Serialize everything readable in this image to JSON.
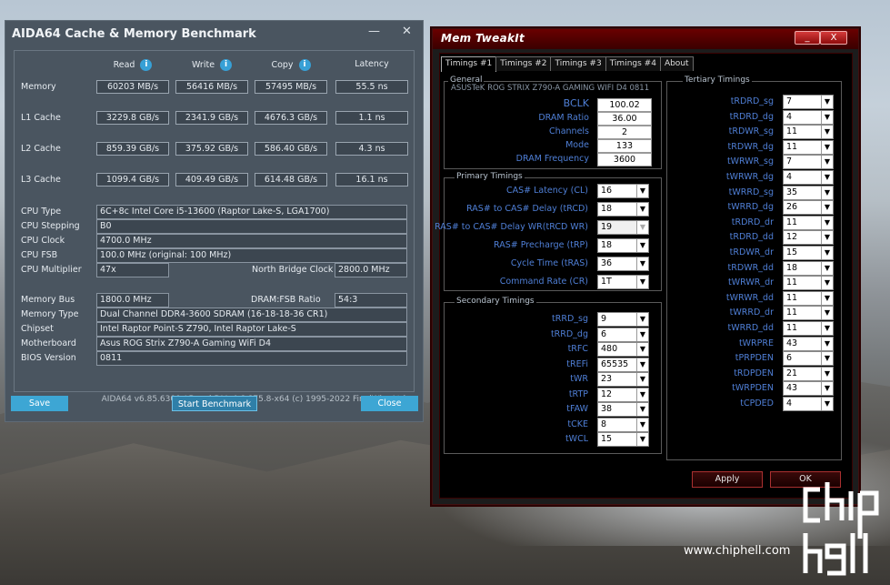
{
  "aida": {
    "title": "AIDA64 Cache & Memory Benchmark",
    "minimize": "—",
    "close": "✕",
    "headers": {
      "read": "Read",
      "write": "Write",
      "copy": "Copy",
      "latency": "Latency"
    },
    "rows": [
      {
        "label": "Memory",
        "read": "60203 MB/s",
        "write": "56416 MB/s",
        "copy": "57495 MB/s",
        "latency": "55.5 ns"
      },
      {
        "label": "L1 Cache",
        "read": "3229.8 GB/s",
        "write": "2341.9 GB/s",
        "copy": "4676.3 GB/s",
        "latency": "1.1 ns"
      },
      {
        "label": "L2 Cache",
        "read": "859.39 GB/s",
        "write": "375.92 GB/s",
        "copy": "586.40 GB/s",
        "latency": "4.3 ns"
      },
      {
        "label": "L3 Cache",
        "read": "1099.4 GB/s",
        "write": "409.49 GB/s",
        "copy": "614.48 GB/s",
        "latency": "16.1 ns"
      }
    ],
    "cpu": {
      "type_label": "CPU Type",
      "type": "6C+8c Intel Core i5-13600  (Raptor Lake-S, LGA1700)",
      "stepping_label": "CPU Stepping",
      "stepping": "B0",
      "clock_label": "CPU Clock",
      "clock": "4700.0 MHz",
      "fsb_label": "CPU FSB",
      "fsb": "100.0 MHz  (original: 100 MHz)",
      "mult_label": "CPU Multiplier",
      "mult": "47x",
      "nb_label": "North Bridge Clock",
      "nb": "2800.0 MHz"
    },
    "mem": {
      "bus_label": "Memory Bus",
      "bus": "1800.0 MHz",
      "ratio_label": "DRAM:FSB Ratio",
      "ratio": "54:3",
      "type_label": "Memory Type",
      "type": "Dual Channel DDR4-3600 SDRAM  (16-18-18-36 CR1)",
      "chipset_label": "Chipset",
      "chipset": "Intel Raptor Point-S Z790, Intel Raptor Lake-S",
      "mb_label": "Motherboard",
      "mb": "Asus ROG Strix Z790-A Gaming WiFi D4",
      "bios_label": "BIOS Version",
      "bios": "0811"
    },
    "copyright": "AIDA64 v6.85.6300 / BenchDLL 4.6.875.8-x64  (c) 1995-2022 FinalWire Ltd.",
    "save": "Save",
    "start": "Start Benchmark",
    "close_btn": "Close"
  },
  "mti": {
    "title": "Mem TweakIt",
    "min": "_",
    "close": "X",
    "tabs": [
      "Timings #1",
      "Timings #2",
      "Timings #3",
      "Timings #4",
      "About"
    ],
    "general": {
      "title": "General",
      "board": "ASUSTeK ROG STRIX Z790-A GAMING WIFI D4 0811",
      "rows": [
        {
          "label": "BCLK",
          "value": "100.02"
        },
        {
          "label": "DRAM Ratio",
          "value": "36.00"
        },
        {
          "label": "Channels",
          "value": "2"
        },
        {
          "label": "Mode",
          "value": "133"
        },
        {
          "label": "DRAM Frequency",
          "value": "3600"
        }
      ]
    },
    "primary": {
      "title": "Primary Timings",
      "rows": [
        {
          "label": "CAS# Latency (CL)",
          "value": "16"
        },
        {
          "label": "RAS# to CAS# Delay (tRCD)",
          "value": "18"
        },
        {
          "label": "RAS# to CAS# Delay WR(tRCD WR)",
          "value": "19"
        },
        {
          "label": "RAS# Precharge (tRP)",
          "value": "18"
        },
        {
          "label": "Cycle Time (tRAS)",
          "value": "36"
        },
        {
          "label": "Command Rate (CR)",
          "value": "1T"
        }
      ]
    },
    "secondary": {
      "title": "Secondary Timings",
      "rows": [
        {
          "label": "tRRD_sg",
          "value": "9"
        },
        {
          "label": "tRRD_dg",
          "value": "6"
        },
        {
          "label": "tRFC",
          "value": "480"
        },
        {
          "label": "tREFi",
          "value": "65535"
        },
        {
          "label": "tWR",
          "value": "23"
        },
        {
          "label": "tRTP",
          "value": "12"
        },
        {
          "label": "tFAW",
          "value": "38"
        },
        {
          "label": "tCKE",
          "value": "8"
        },
        {
          "label": "tWCL",
          "value": "15"
        }
      ]
    },
    "tertiary": {
      "title": "Tertiary Timings",
      "rows": [
        {
          "label": "tRDRD_sg",
          "value": "7"
        },
        {
          "label": "tRDRD_dg",
          "value": "4"
        },
        {
          "label": "tRDWR_sg",
          "value": "11"
        },
        {
          "label": "tRDWR_dg",
          "value": "11"
        },
        {
          "label": "tWRWR_sg",
          "value": "7"
        },
        {
          "label": "tWRWR_dg",
          "value": "4"
        },
        {
          "label": "tWRRD_sg",
          "value": "35"
        },
        {
          "label": "tWRRD_dg",
          "value": "26"
        },
        {
          "label": "tRDRD_dr",
          "value": "11"
        },
        {
          "label": "tRDRD_dd",
          "value": "12"
        },
        {
          "label": "tRDWR_dr",
          "value": "15"
        },
        {
          "label": "tRDWR_dd",
          "value": "18"
        },
        {
          "label": "tWRWR_dr",
          "value": "11"
        },
        {
          "label": "tWRWR_dd",
          "value": "11"
        },
        {
          "label": "tWRRD_dr",
          "value": "11"
        },
        {
          "label": "tWRRD_dd",
          "value": "11"
        },
        {
          "label": "tWRPRE",
          "value": "43"
        },
        {
          "label": "tPRPDEN",
          "value": "6"
        },
        {
          "label": "tRDPDEN",
          "value": "21"
        },
        {
          "label": "tWRPDEN",
          "value": "43"
        },
        {
          "label": "tCPDED",
          "value": "4"
        }
      ]
    },
    "apply": "Apply",
    "ok": "OK"
  },
  "watermark": {
    "url": "www.chiphell.com",
    "logo": "chip hell"
  }
}
